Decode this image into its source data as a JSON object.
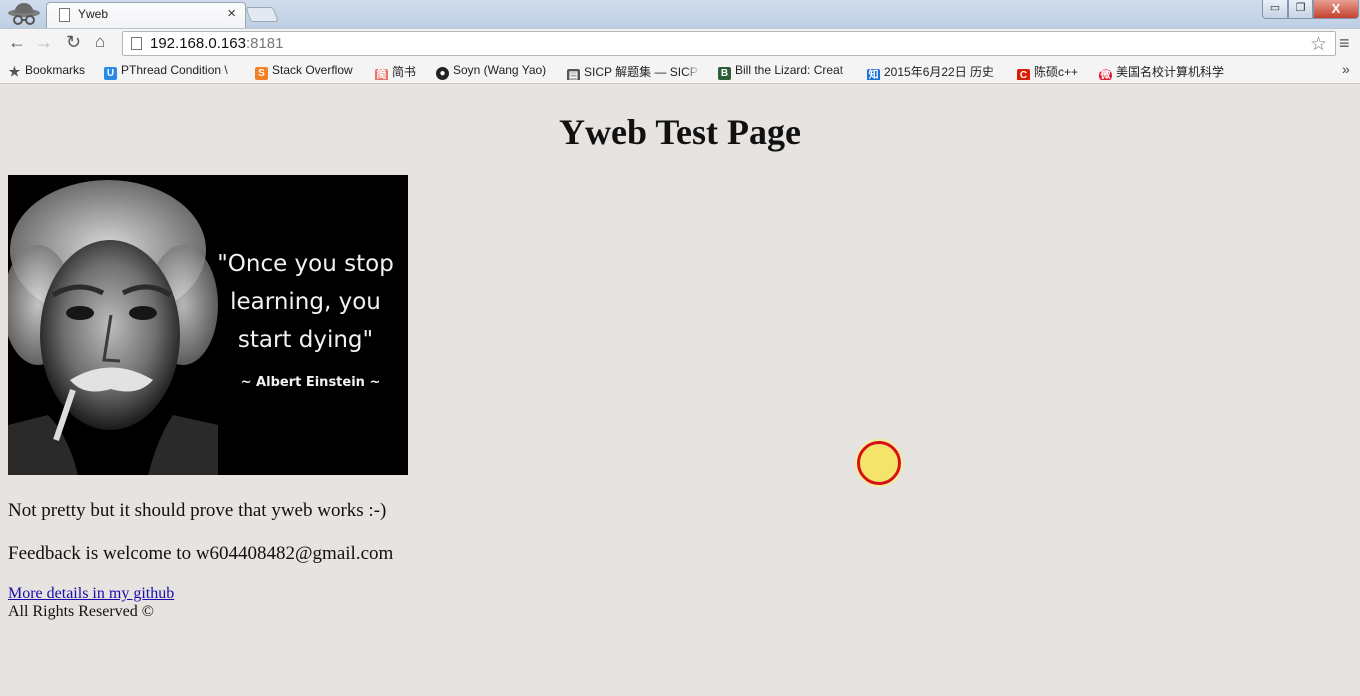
{
  "browser": {
    "tab_title": "Yweb",
    "tab_close": "×",
    "url_host": "192.168.0.163",
    "url_port": ":8181",
    "window_controls": {
      "minimize": "▭",
      "maximize": "❐",
      "close": "X"
    },
    "nav": {
      "back": "←",
      "forward": "→",
      "reload": "↻",
      "home": "⌂",
      "star": "☆",
      "menu": "≡"
    }
  },
  "bookmarks": {
    "label": "Bookmarks",
    "items": [
      {
        "label": "PThread Condition \\",
        "icon": "uestc-icon",
        "color": "#2a8ae8"
      },
      {
        "label": "Stack Overflow",
        "icon": "stackoverflow-icon",
        "color": "#f48024"
      },
      {
        "label": "简书",
        "icon": "jianshu-icon",
        "color": "#e8766a"
      },
      {
        "label": "Soyn (Wang Yao)",
        "icon": "github-icon",
        "color": "#222222"
      },
      {
        "label": "SICP 解题集 — SICP",
        "icon": "book-icon",
        "color": "#555555"
      },
      {
        "label": "Bill the Lizard: Creat",
        "icon": "lizard-icon",
        "color": "#2e5d3a"
      },
      {
        "label": "2015年6月22日 历史",
        "icon": "zhihu-icon",
        "color": "#1a6fd8"
      },
      {
        "label": "陈硕c++",
        "icon": "csdn-icon",
        "color": "#d81e06"
      },
      {
        "label": "美国名校计算机科学",
        "icon": "weibo-icon",
        "color": "#e6162d"
      }
    ],
    "overflow": "»"
  },
  "page": {
    "title": "Yweb Test Page",
    "image": {
      "quote": "\"Once you stop learning, you start dying\"",
      "author": "~ Albert Einstein ~"
    },
    "text1": "Not pretty but it should prove that yweb works :-)",
    "text2": "Feedback is welcome to w604408482@gmail.com",
    "link": "More details in my github",
    "rights": "All Rights Reserved ©"
  }
}
